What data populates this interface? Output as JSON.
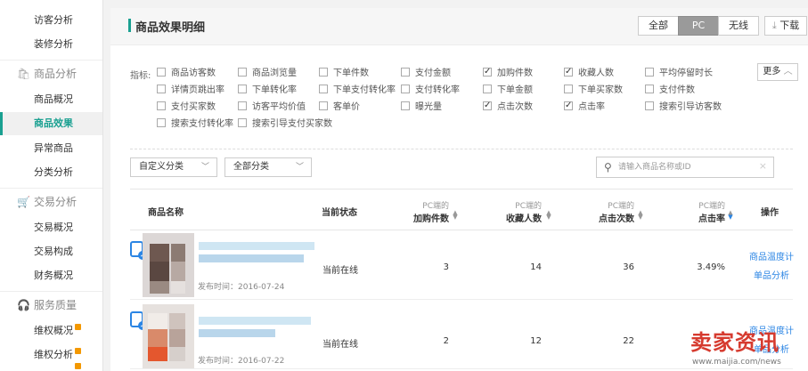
{
  "sidebar": {
    "items": [
      {
        "label": "访客分析"
      },
      {
        "label": "装修分析"
      },
      {
        "label": "商品概况"
      },
      {
        "label": "商品效果"
      },
      {
        "label": "异常商品"
      },
      {
        "label": "分类分析"
      },
      {
        "label": "交易概况"
      },
      {
        "label": "交易构成"
      },
      {
        "label": "财务概况"
      },
      {
        "label": "维权概况"
      },
      {
        "label": "维权分析"
      }
    ],
    "groups": [
      {
        "label": "商品分析",
        "icon": "bag-icon"
      },
      {
        "label": "交易分析",
        "icon": "cart-icon"
      },
      {
        "label": "服务质量",
        "icon": "headset-icon"
      }
    ]
  },
  "header": {
    "title": "商品效果明细",
    "segments": [
      "全部",
      "PC",
      "无线"
    ],
    "active_segment": "PC",
    "download_label": "下载"
  },
  "metrics": {
    "label": "指标:",
    "items": [
      {
        "label": "商品访客数",
        "checked": false
      },
      {
        "label": "商品浏览量",
        "checked": false
      },
      {
        "label": "下单件数",
        "checked": false
      },
      {
        "label": "支付金额",
        "checked": false
      },
      {
        "label": "加购件数",
        "checked": true
      },
      {
        "label": "收藏人数",
        "checked": true
      },
      {
        "label": "平均停留时长",
        "checked": false
      },
      {
        "label": "详情页跳出率",
        "checked": false
      },
      {
        "label": "下单转化率",
        "checked": false
      },
      {
        "label": "下单支付转化率",
        "checked": false
      },
      {
        "label": "支付转化率",
        "checked": false
      },
      {
        "label": "下单金额",
        "checked": false
      },
      {
        "label": "下单买家数",
        "checked": false
      },
      {
        "label": "支付件数",
        "checked": false
      },
      {
        "label": "支付买家数",
        "checked": false
      },
      {
        "label": "访客平均价值",
        "checked": false
      },
      {
        "label": "客单价",
        "checked": false
      },
      {
        "label": "曝光量",
        "checked": false
      },
      {
        "label": "点击次数",
        "checked": true
      },
      {
        "label": "点击率",
        "checked": true
      },
      {
        "label": "搜索引导访客数",
        "checked": false
      },
      {
        "label": "搜索支付转化率",
        "checked": false
      },
      {
        "label": "搜索引导支付买家数",
        "checked": false
      }
    ],
    "more_label": "更多"
  },
  "filters": {
    "custom_category": "自定义分类",
    "all_category": "全部分类",
    "search_placeholder": "请输入商品名称或ID"
  },
  "table": {
    "headers": {
      "name": "商品名称",
      "status": "当前状态",
      "col1_sub": "PC端的",
      "col1_main": "加购件数",
      "col2_sub": "PC端的",
      "col2_main": "收藏人数",
      "col3_sub": "PC端的",
      "col3_main": "点击次数",
      "col4_sub": "PC端的",
      "col4_main": "点击率",
      "actions": "操作"
    },
    "rows": [
      {
        "published": "发布时间：2016-07-24",
        "status": "当前在线",
        "cart": "3",
        "fav": "14",
        "clicks": "36",
        "ctr": "3.49%",
        "op1": "商品温度计",
        "op2": "单品分析"
      },
      {
        "published": "发布时间：2016-07-22",
        "status": "当前在线",
        "cart": "2",
        "fav": "12",
        "clicks": "22",
        "ctr": "",
        "op1": "商品温度计",
        "op2": "单品分析"
      }
    ]
  },
  "watermark": {
    "text": "卖家资讯",
    "url": "www.maijia.com/news"
  }
}
